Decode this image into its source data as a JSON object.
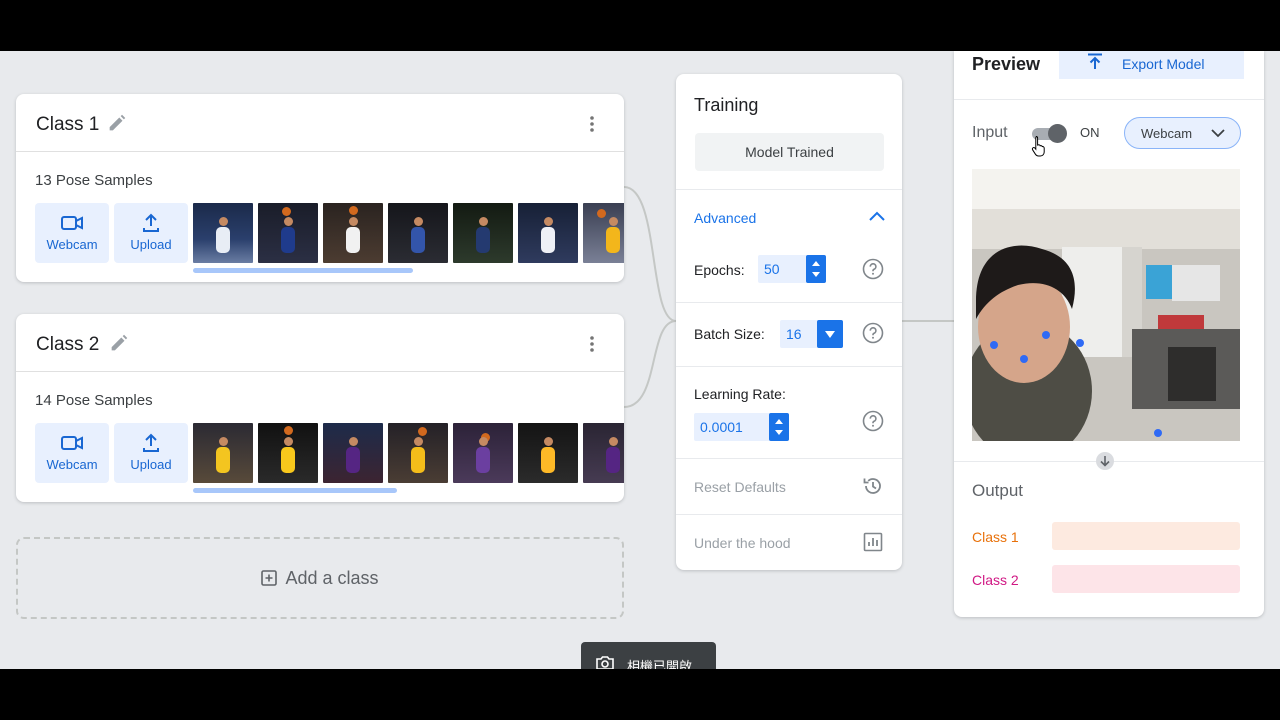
{
  "class_cards": [
    {
      "title": "Class 1",
      "samples": "13 Pose Samples",
      "webcam_label": "Webcam",
      "upload_label": "Upload",
      "thumb_count": 7,
      "scroll_fraction": 0.51
    },
    {
      "title": "Class 2",
      "samples": "14 Pose Samples",
      "webcam_label": "Webcam",
      "upload_label": "Upload",
      "thumb_count": 7,
      "scroll_fraction": 0.48
    }
  ],
  "add_class_label": "Add a class",
  "training": {
    "title": "Training",
    "status_button": "Model Trained",
    "advanced_label": "Advanced",
    "epochs_label": "Epochs:",
    "epochs_value": "50",
    "batch_label": "Batch Size:",
    "batch_value": "16",
    "lr_label": "Learning Rate:",
    "lr_value": "0.0001",
    "reset_label": "Reset Defaults",
    "hood_label": "Under the hood"
  },
  "preview": {
    "title": "Preview",
    "export_label": "Export Model",
    "input_label": "Input",
    "toggle_state": "ON",
    "source_select": "Webcam",
    "output_label": "Output",
    "outputs": [
      {
        "name": "Class 1",
        "color": "#e8710a",
        "bar_color": "#fdeae0",
        "confidence": 0.0
      },
      {
        "name": "Class 2",
        "color": "#d01884",
        "bar_color": "#fde4e8",
        "confidence": 0.0
      }
    ]
  },
  "toast": {
    "text": "相機已開啟"
  },
  "colors": {
    "accent": "#1a73e8",
    "canvas": "#e8eaed",
    "card": "#ffffff"
  }
}
